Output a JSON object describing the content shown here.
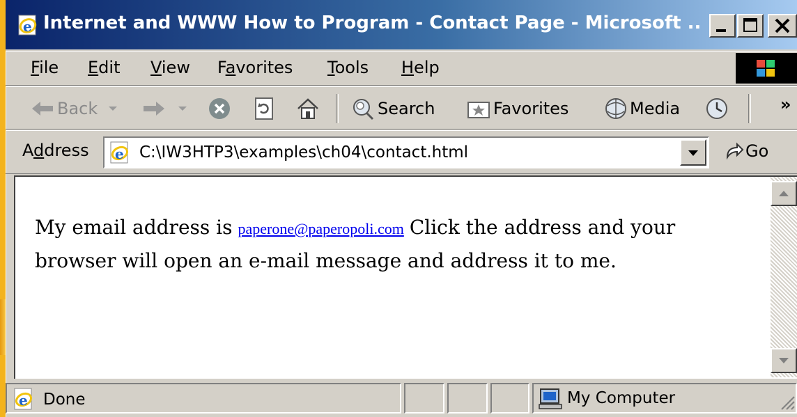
{
  "window": {
    "title": "Internet and WWW How to Program - Contact Page - Microsoft ...",
    "buttons": {
      "minimize": "minimize",
      "maximize": "maximize",
      "close": "close"
    }
  },
  "menu": {
    "items": [
      {
        "label": "File",
        "mnemonic": "F",
        "rest": "ile"
      },
      {
        "label": "Edit",
        "mnemonic": "E",
        "rest": "dit"
      },
      {
        "label": "View",
        "mnemonic": "V",
        "rest": "iew"
      },
      {
        "label": "Favorites",
        "prefix": "F",
        "mnemonic": "a",
        "rest": "vorites"
      },
      {
        "label": "Tools",
        "mnemonic": "T",
        "rest": "ools"
      },
      {
        "label": "Help",
        "mnemonic": "H",
        "rest": "elp"
      }
    ]
  },
  "toolbar": {
    "back_label": "Back",
    "search_label": "Search",
    "favorites_label": "Favorites",
    "media_label": "Media",
    "more_label": "»",
    "icons": [
      "back-arrow-icon",
      "forward-arrow-icon",
      "stop-icon",
      "refresh-icon",
      "home-icon",
      "search-icon",
      "favorites-icon",
      "media-icon",
      "history-icon"
    ]
  },
  "address": {
    "label_prefix": "A",
    "label_mnemonic": "d",
    "label_rest": "dress",
    "url": "C:\\IW3HTP3\\examples\\ch04\\contact.html",
    "go_label": "Go"
  },
  "content": {
    "text_before": "My email address is",
    "email": "paperone@paperopoli.com",
    "text_after": "Click the address and your browser will open an e-mail message and address it to me."
  },
  "status": {
    "text": "Done",
    "zone": "My Computer"
  },
  "colors": {
    "titlebar_start": "#0a246a",
    "titlebar_end": "#a6caf0",
    "chrome": "#d4d0c8",
    "link": "#0000ee",
    "background": "#f3b31d"
  }
}
